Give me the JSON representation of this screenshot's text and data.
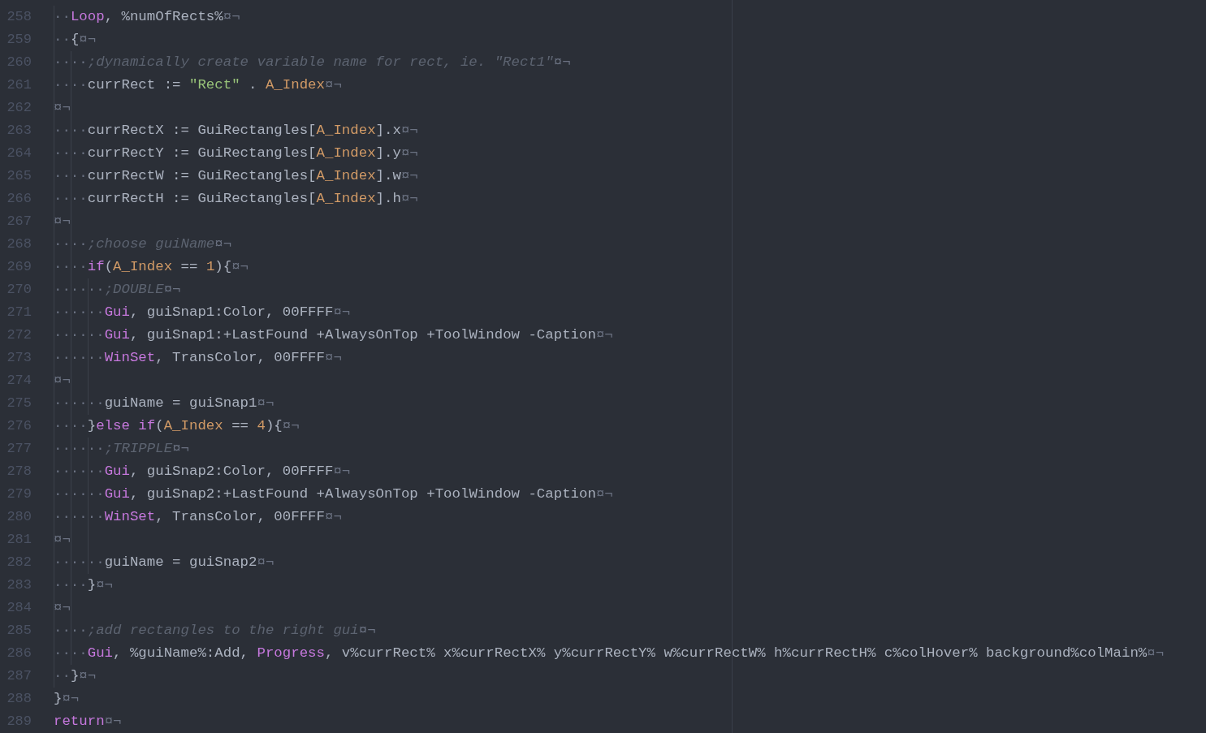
{
  "editor": {
    "lines": [
      {
        "number": "258",
        "indent": "··",
        "tokens": [
          {
            "kind": "keyword",
            "text": "Loop"
          },
          {
            "kind": "plain",
            "text": ", %numOfRects%"
          }
        ],
        "eol": "¤¬"
      },
      {
        "number": "259",
        "indent": "··",
        "tokens": [
          {
            "kind": "plain",
            "text": "{"
          }
        ],
        "eol": "¤¬"
      },
      {
        "number": "260",
        "indent": "····",
        "tokens": [
          {
            "kind": "comment",
            "text": ";dynamically create variable name for rect, ie. \"Rect1\""
          }
        ],
        "eol": "¤¬"
      },
      {
        "number": "261",
        "indent": "····",
        "tokens": [
          {
            "kind": "plain",
            "text": "currRect := "
          },
          {
            "kind": "string",
            "text": "\"Rect\""
          },
          {
            "kind": "plain",
            "text": " . "
          },
          {
            "kind": "constant",
            "text": "A_Index"
          }
        ],
        "eol": "¤¬"
      },
      {
        "number": "262",
        "eol": "¤¬"
      },
      {
        "number": "263",
        "indent": "····",
        "tokens": [
          {
            "kind": "plain",
            "text": "currRectX := GuiRectangles["
          },
          {
            "kind": "constant",
            "text": "A_Index"
          },
          {
            "kind": "plain",
            "text": "].x"
          }
        ],
        "eol": "¤¬"
      },
      {
        "number": "264",
        "indent": "····",
        "tokens": [
          {
            "kind": "plain",
            "text": "currRectY := GuiRectangles["
          },
          {
            "kind": "constant",
            "text": "A_Index"
          },
          {
            "kind": "plain",
            "text": "].y"
          }
        ],
        "eol": "¤¬"
      },
      {
        "number": "265",
        "indent": "····",
        "tokens": [
          {
            "kind": "plain",
            "text": "currRectW := GuiRectangles["
          },
          {
            "kind": "constant",
            "text": "A_Index"
          },
          {
            "kind": "plain",
            "text": "].w"
          }
        ],
        "eol": "¤¬"
      },
      {
        "number": "266",
        "indent": "····",
        "tokens": [
          {
            "kind": "plain",
            "text": "currRectH := GuiRectangles["
          },
          {
            "kind": "constant",
            "text": "A_Index"
          },
          {
            "kind": "plain",
            "text": "].h"
          }
        ],
        "eol": "¤¬"
      },
      {
        "number": "267",
        "eol": "¤¬"
      },
      {
        "number": "268",
        "indent": "····",
        "tokens": [
          {
            "kind": "comment",
            "text": ";choose guiName"
          }
        ],
        "eol": "¤¬"
      },
      {
        "number": "269",
        "indent": "····",
        "tokens": [
          {
            "kind": "keyword",
            "text": "if"
          },
          {
            "kind": "plain",
            "text": "("
          },
          {
            "kind": "constant",
            "text": "A_Index"
          },
          {
            "kind": "plain",
            "text": " == "
          },
          {
            "kind": "constant",
            "text": "1"
          },
          {
            "kind": "plain",
            "text": "){"
          }
        ],
        "eol": "¤¬"
      },
      {
        "number": "270",
        "indent": "······",
        "tokens": [
          {
            "kind": "comment",
            "text": ";DOUBLE"
          }
        ],
        "eol": "¤¬"
      },
      {
        "number": "271",
        "indent": "······",
        "tokens": [
          {
            "kind": "keyword",
            "text": "Gui"
          },
          {
            "kind": "plain",
            "text": ", guiSnap1:Color, 00FFFF"
          }
        ],
        "eol": "¤¬"
      },
      {
        "number": "272",
        "indent": "······",
        "tokens": [
          {
            "kind": "keyword",
            "text": "Gui"
          },
          {
            "kind": "plain",
            "text": ", guiSnap1:+LastFound +AlwaysOnTop +ToolWindow -Caption"
          }
        ],
        "eol": "¤¬"
      },
      {
        "number": "273",
        "indent": "······",
        "tokens": [
          {
            "kind": "keyword",
            "text": "WinSet"
          },
          {
            "kind": "plain",
            "text": ", TransColor, 00FFFF"
          }
        ],
        "eol": "¤¬"
      },
      {
        "number": "274",
        "eol": "¤¬"
      },
      {
        "number": "275",
        "indent": "······",
        "tokens": [
          {
            "kind": "plain",
            "text": "guiName = guiSnap1"
          }
        ],
        "eol": "¤¬"
      },
      {
        "number": "276",
        "indent": "····",
        "tokens": [
          {
            "kind": "plain",
            "text": "}"
          },
          {
            "kind": "keyword",
            "text": "else if"
          },
          {
            "kind": "plain",
            "text": "("
          },
          {
            "kind": "constant",
            "text": "A_Index"
          },
          {
            "kind": "plain",
            "text": " == "
          },
          {
            "kind": "constant",
            "text": "4"
          },
          {
            "kind": "plain",
            "text": "){"
          }
        ],
        "eol": "¤¬"
      },
      {
        "number": "277",
        "indent": "······",
        "tokens": [
          {
            "kind": "comment",
            "text": ";TRIPPLE"
          }
        ],
        "eol": "¤¬"
      },
      {
        "number": "278",
        "indent": "······",
        "tokens": [
          {
            "kind": "keyword",
            "text": "Gui"
          },
          {
            "kind": "plain",
            "text": ", guiSnap2:Color, 00FFFF"
          }
        ],
        "eol": "¤¬"
      },
      {
        "number": "279",
        "indent": "······",
        "tokens": [
          {
            "kind": "keyword",
            "text": "Gui"
          },
          {
            "kind": "plain",
            "text": ", guiSnap2:+LastFound +AlwaysOnTop +ToolWindow -Caption"
          }
        ],
        "eol": "¤¬"
      },
      {
        "number": "280",
        "indent": "······",
        "tokens": [
          {
            "kind": "keyword",
            "text": "WinSet"
          },
          {
            "kind": "plain",
            "text": ", TransColor, 00FFFF"
          }
        ],
        "eol": "¤¬"
      },
      {
        "number": "281",
        "eol": "¤¬"
      },
      {
        "number": "282",
        "indent": "······",
        "tokens": [
          {
            "kind": "plain",
            "text": "guiName = guiSnap2"
          }
        ],
        "eol": "¤¬"
      },
      {
        "number": "283",
        "indent": "····",
        "tokens": [
          {
            "kind": "plain",
            "text": "}"
          }
        ],
        "eol": "¤¬"
      },
      {
        "number": "284",
        "eol": "¤¬"
      },
      {
        "number": "285",
        "indent": "····",
        "tokens": [
          {
            "kind": "comment",
            "text": ";add rectangles to the right gui"
          }
        ],
        "eol": "¤¬"
      },
      {
        "number": "286",
        "indent": "····",
        "tokens": [
          {
            "kind": "keyword",
            "text": "Gui"
          },
          {
            "kind": "plain",
            "text": ", %guiName%:Add, "
          },
          {
            "kind": "keyword",
            "text": "Progress"
          },
          {
            "kind": "plain",
            "text": ", v%currRect% x%currRectX% y%currRectY% w%currRectW% h%currRectH% c%colHover% background%colMain%"
          }
        ],
        "eol": "¤¬"
      },
      {
        "number": "287",
        "indent": "··",
        "tokens": [
          {
            "kind": "plain",
            "text": "}"
          }
        ],
        "eol": "¤¬"
      },
      {
        "number": "288",
        "tokens": [
          {
            "kind": "plain",
            "text": "}"
          }
        ],
        "eol": "¤¬"
      },
      {
        "number": "289",
        "tokens": [
          {
            "kind": "keyword",
            "text": "return"
          }
        ],
        "eol": "¤¬"
      }
    ]
  }
}
